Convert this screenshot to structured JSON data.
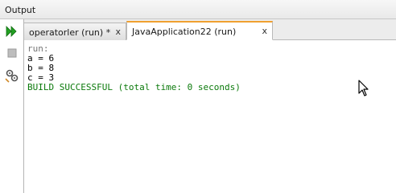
{
  "window": {
    "title": "Output"
  },
  "tabs": [
    {
      "label": "operatorler (run) *",
      "close_label": "x"
    },
    {
      "label": "JavaApplication22 (run)",
      "close_label": "x"
    }
  ],
  "toolbar": {
    "icons": [
      "rerun-icon",
      "stop-icon",
      "settings-icon"
    ]
  },
  "console": {
    "lines": [
      "run:",
      "a = 6",
      "b = 8",
      "c = 3",
      "BUILD SUCCESSFUL (total time: 0 seconds)"
    ]
  },
  "colors": {
    "accent_tab": "#f0a030",
    "success": "#0b7a0b",
    "rerun_green": "#22a022"
  }
}
